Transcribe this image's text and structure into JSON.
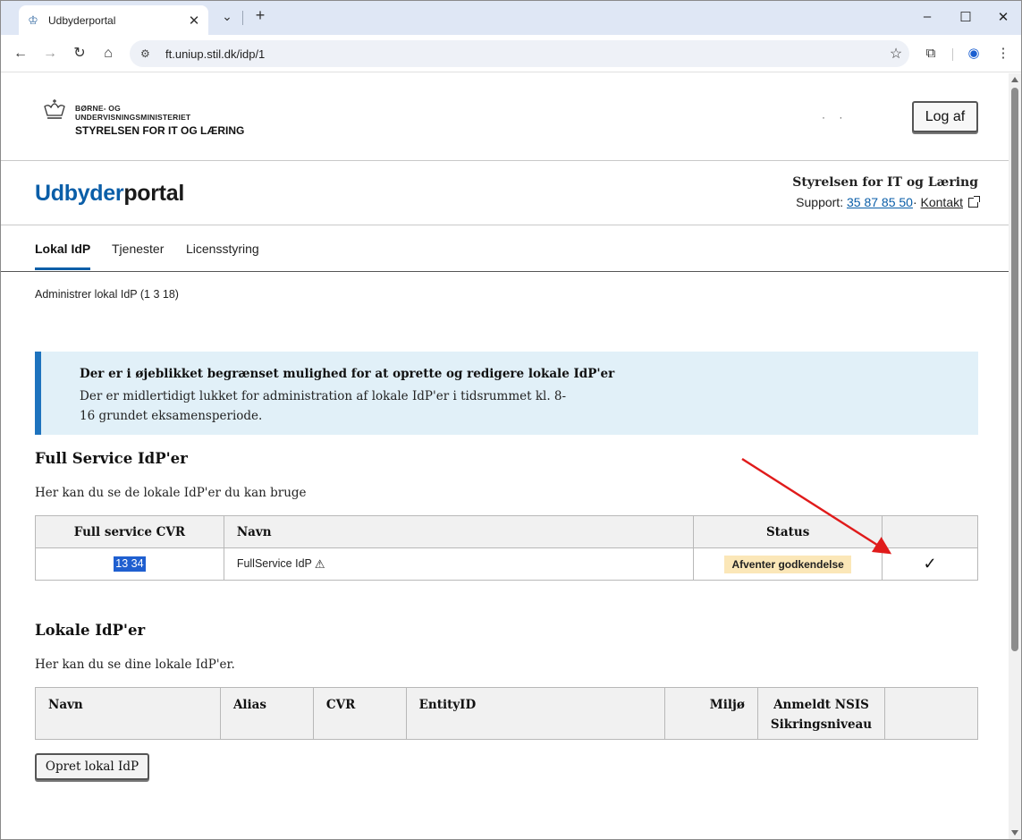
{
  "browser": {
    "tab_title": "Udbyderportal",
    "url": "ft.uniup.stil.dk/idp/1 ",
    "new_tab_symbol": "+"
  },
  "header": {
    "ministry_line1": "BØRNE- OG",
    "ministry_line2": "UNDERVISNINGSMINISTERIET",
    "agency": "STYRELSEN FOR IT OG LÆRING",
    "user_masked": "· ·",
    "logout_label": "Log af"
  },
  "portal": {
    "title_part1": "Udbyder",
    "title_part2": "portal",
    "org_name": "Styrelsen for IT og Læring",
    "support_label": "Support:",
    "support_phone": "35 87 85 50",
    "support_sep": "·",
    "contact_label": "Kontakt"
  },
  "nav": {
    "tabs": [
      {
        "label": "Lokal IdP"
      },
      {
        "label": "Tjenester"
      },
      {
        "label": "Licensstyring"
      }
    ]
  },
  "breadcrumb": "Administrer lokal IdP (1    3    18)",
  "alert": {
    "title": "Der er i øjeblikket begrænset mulighed for at oprette og redigere lokale IdP'er",
    "body": "Der er midlertidigt lukket for administration af lokale IdP'er i tidsrummet kl. 8-16 grundet eksamensperiode."
  },
  "full_service": {
    "title": "Full Service IdP'er",
    "description": "Her kan du se de lokale IdP'er du kan bruge",
    "columns": [
      "Full service CVR",
      "Navn",
      "Status",
      ""
    ],
    "rows": [
      {
        "cvr": "13  34",
        "name": "FullService IdP",
        "status": "Afventer godkendelse"
      }
    ]
  },
  "lokale": {
    "title": "Lokale IdP'er",
    "description": "Her kan du se dine lokale IdP'er.",
    "columns": {
      "navn": "Navn",
      "alias": "Alias",
      "cvr": "CVR",
      "entity": "EntityID",
      "miljo": "Miljø",
      "nsis_line1": "Anmeldt NSIS",
      "nsis_line2": "Sikringsniveau"
    },
    "create_label": "Opret lokal IdP"
  },
  "colors": {
    "brand_blue": "#0a5ea8",
    "alert_bg": "#e1f0f8",
    "alert_border": "#1e73be",
    "status_badge_bg": "#fbe7b8",
    "annotation_arrow": "#e01b1b"
  }
}
